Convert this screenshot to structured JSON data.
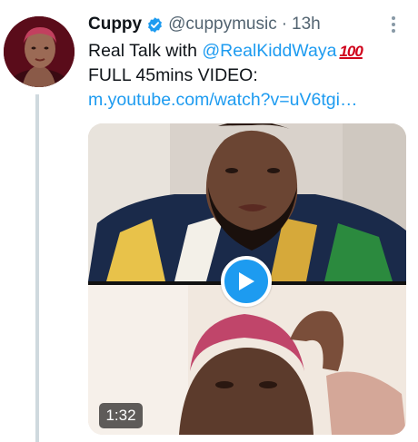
{
  "user": {
    "display_name": "Cuppy",
    "handle": "@cuppymusic",
    "separator": "·",
    "time": "13h",
    "verified": true
  },
  "tweet": {
    "line1_text": "Real Talk with ",
    "mention": "@RealKiddWaya",
    "emoji": "100",
    "line2_text": "FULL 45mins VIDEO:",
    "link_text": "m.youtube.com/watch?v=uV6tgi…"
  },
  "media": {
    "type": "video",
    "duration": "1:32"
  },
  "icons": {
    "verified": "verified-badge-icon",
    "more": "more-vertical-icon",
    "play": "play-icon"
  },
  "colors": {
    "accent": "#1d9bf0",
    "text": "#0f1419",
    "secondary": "#536471",
    "thread_line": "#cfd9de"
  }
}
